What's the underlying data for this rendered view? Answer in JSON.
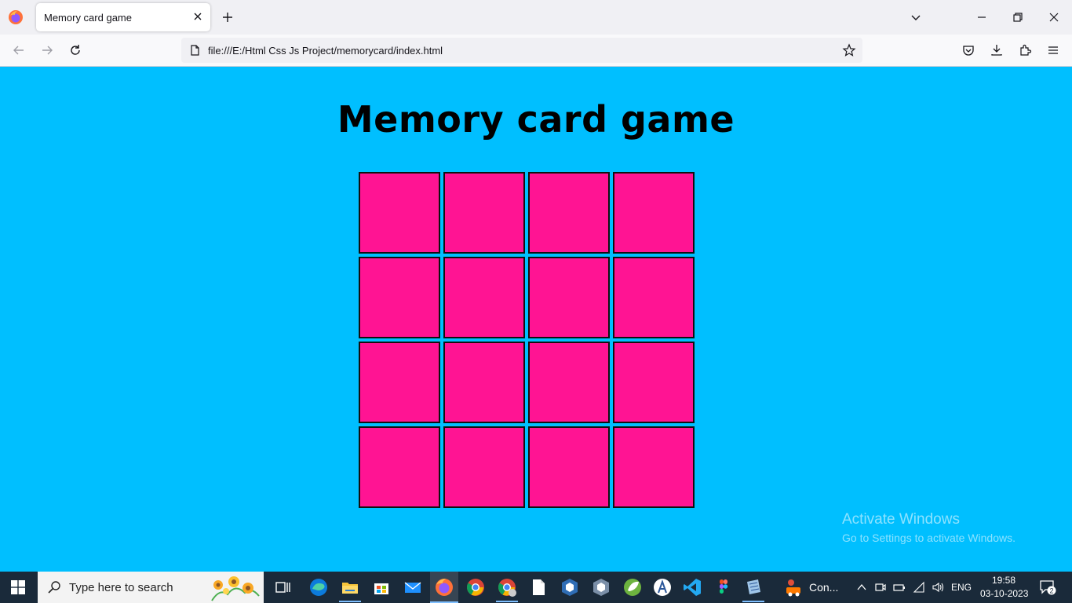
{
  "browser": {
    "tab_title": "Memory card game",
    "url": "file:///E:/Html Css Js Project/memorycard/index.html"
  },
  "page": {
    "title": "Memory card game",
    "card_color": "#FF1493",
    "background_color": "#00BFFF",
    "cards": [
      {
        "state": "face-down"
      },
      {
        "state": "face-down"
      },
      {
        "state": "face-down"
      },
      {
        "state": "face-down"
      },
      {
        "state": "face-down"
      },
      {
        "state": "face-down"
      },
      {
        "state": "face-down"
      },
      {
        "state": "face-down"
      },
      {
        "state": "face-down"
      },
      {
        "state": "face-down"
      },
      {
        "state": "face-down"
      },
      {
        "state": "face-down"
      },
      {
        "state": "face-down"
      },
      {
        "state": "face-down"
      },
      {
        "state": "face-down"
      },
      {
        "state": "face-down"
      }
    ]
  },
  "watermark": {
    "line1": "Activate Windows",
    "line2": "Go to Settings to activate Windows."
  },
  "taskbar": {
    "search_placeholder": "Type here to search",
    "con_label": "Con...",
    "language": "ENG",
    "time": "19:58",
    "date": "03-10-2023",
    "notification_count": "2"
  }
}
